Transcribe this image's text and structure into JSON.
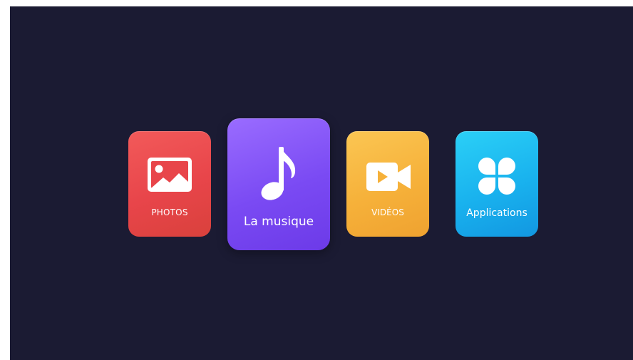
{
  "menu": {
    "tiles": [
      {
        "id": "photos",
        "label": "PHOTOS",
        "icon": "image-icon",
        "color": "#e8454a"
      },
      {
        "id": "music",
        "label": "La musique",
        "icon": "music-note-icon",
        "color": "#7a4af3",
        "focused": true
      },
      {
        "id": "videos",
        "label": "VIDÉOS",
        "icon": "video-camera-icon",
        "color": "#f6b13a"
      },
      {
        "id": "apps",
        "label": "Applications",
        "icon": "apps-grid-icon",
        "color": "#19b2ee"
      }
    ]
  },
  "colors": {
    "background": "#1b1b33"
  }
}
